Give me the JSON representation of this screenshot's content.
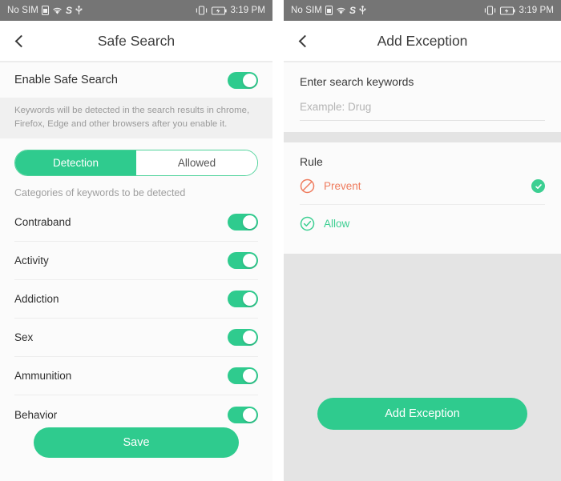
{
  "statusbar": {
    "carrier": "No SIM",
    "sim_icon": "sim-card-icon",
    "wifi_icon": "wifi-icon",
    "sync_letter": "S",
    "usb_icon": "usb-icon",
    "vibrate_icon": "vibrate-icon",
    "battery_icon": "battery-charging-icon",
    "time": "3:19 PM"
  },
  "colors": {
    "accent_green": "#2fcb8e",
    "allow_green": "#3ccf92",
    "prevent_orange": "#ef7c5e",
    "statusbar_gray": "#757575",
    "panel_gray": "#e4e4e4"
  },
  "left_screen": {
    "back_icon": "back-chevron-icon",
    "title": "Safe Search",
    "enable_row": {
      "label": "Enable Safe Search",
      "toggle_state": "on"
    },
    "hint": "Keywords will be detected in the search results in chrome, Firefox, Edge and other browsers after you enable it.",
    "tabs": [
      {
        "label": "Detection",
        "selected": true
      },
      {
        "label": "Allowed",
        "selected": false
      }
    ],
    "categories_note": "Categories of keywords to be detected",
    "categories": [
      {
        "label": "Contraband",
        "toggle_state": "on"
      },
      {
        "label": "Activity",
        "toggle_state": "on"
      },
      {
        "label": "Addiction",
        "toggle_state": "on"
      },
      {
        "label": "Sex",
        "toggle_state": "on"
      },
      {
        "label": "Ammunition",
        "toggle_state": "on"
      },
      {
        "label": "Behavior",
        "toggle_state": "on"
      }
    ],
    "save_label": "Save"
  },
  "right_screen": {
    "back_icon": "back-chevron-icon",
    "title": "Add Exception",
    "keywords_label": "Enter search keywords",
    "keywords_value": "",
    "keywords_placeholder": "Example: Drug",
    "rule_label": "Rule",
    "rules": [
      {
        "label": "Prevent",
        "icon": "prohibition-icon",
        "selected": true
      },
      {
        "label": "Allow",
        "icon": "check-circle-icon",
        "selected": false
      }
    ],
    "add_label": "Add Exception"
  }
}
